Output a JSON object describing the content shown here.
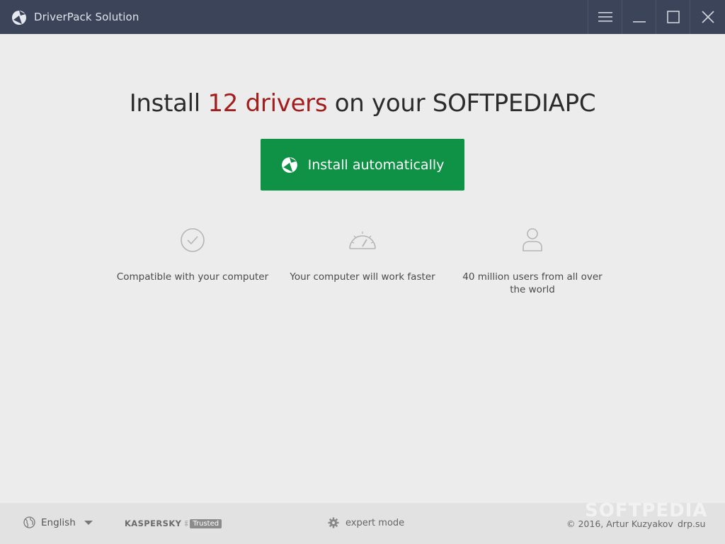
{
  "window": {
    "title": "DriverPack Solution",
    "controls": {
      "menu_icon": "hamburger-icon",
      "minimize_icon": "minimize-icon",
      "maximize_icon": "maximize-icon",
      "close_icon": "close-icon"
    }
  },
  "headline": {
    "prefix": "Install ",
    "highlight": "12 drivers",
    "suffix": " on your SOFTPEDIAPC"
  },
  "install_button": {
    "label": "Install automatically",
    "icon": "driverpack-logo-icon"
  },
  "features": [
    {
      "icon": "checkmark-circle-icon",
      "text": "Compatible with your computer"
    },
    {
      "icon": "speedometer-icon",
      "text": "Your computer will work faster"
    },
    {
      "icon": "user-icon",
      "text": "40 million users from all over the world"
    }
  ],
  "footer": {
    "language": "English",
    "kaspersky_name": "KASPERSKY",
    "kaspersky_lab": "lab",
    "kaspersky_badge": "Trusted",
    "expert_mode": "expert mode",
    "copyright": "© 2016, Artur Kuzyakov",
    "site": "drp.su"
  },
  "watermark": "SOFTPEDIA",
  "colors": {
    "titlebar": "#3b4458",
    "accent_red": "#a31d1d",
    "install_green": "#0f9146",
    "background": "#ececec",
    "footer": "#e2e2e2"
  }
}
